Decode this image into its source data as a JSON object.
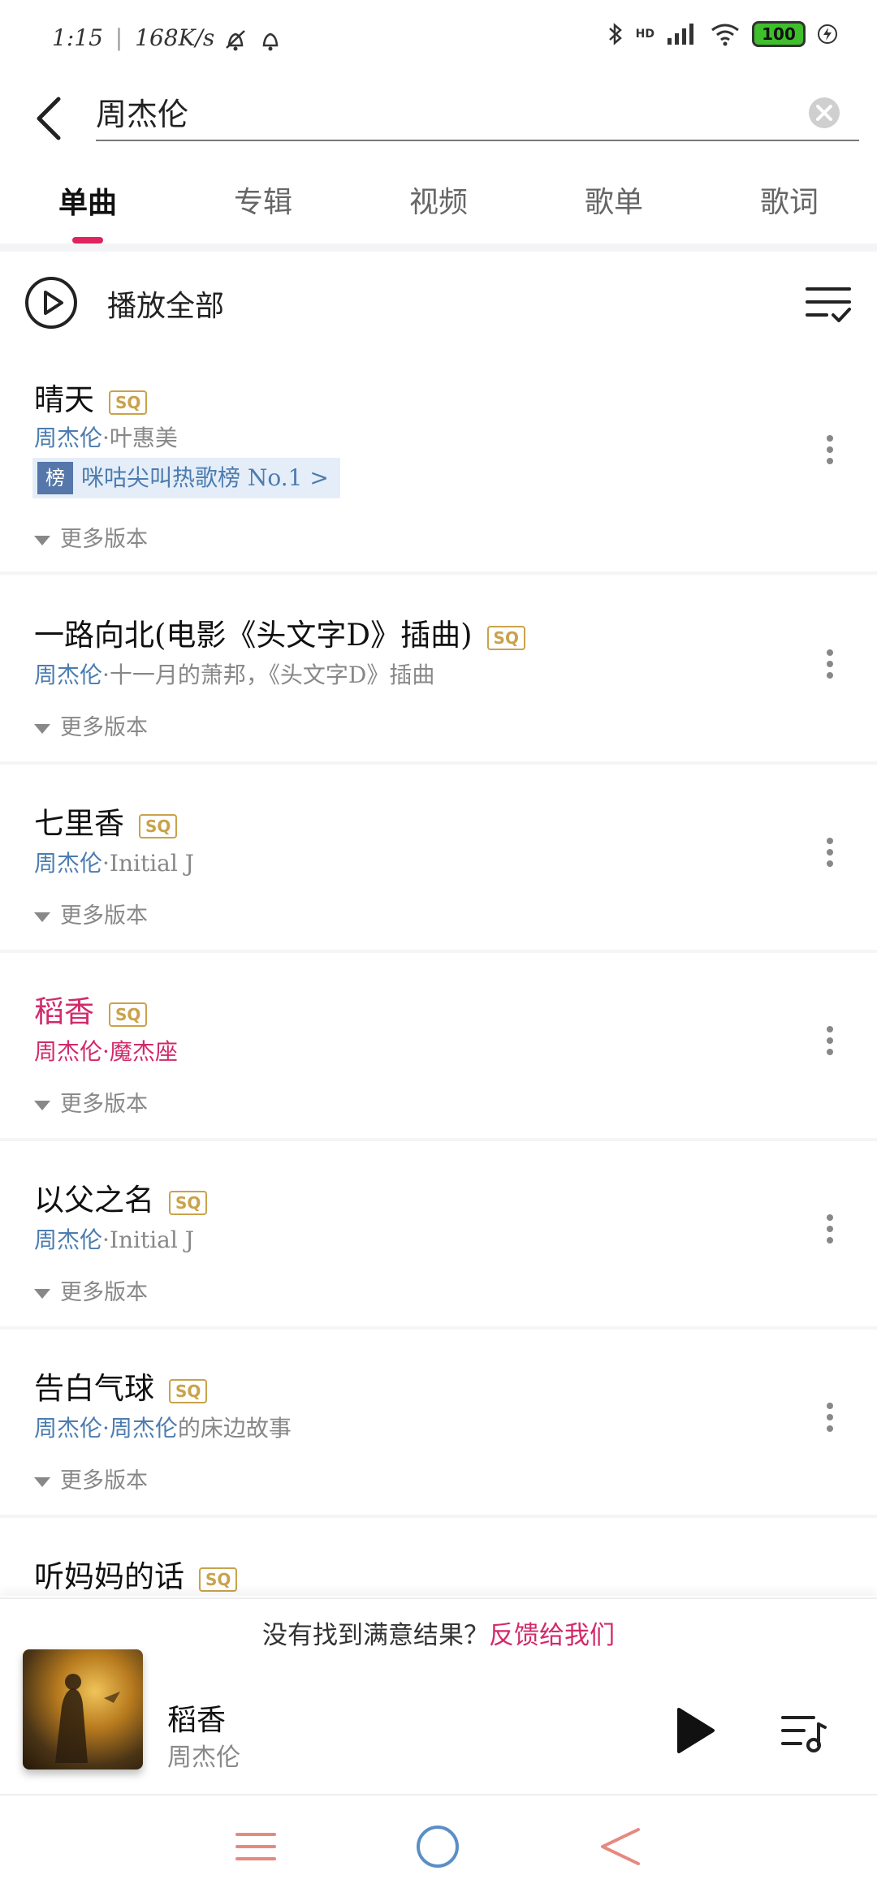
{
  "status_bar": {
    "time": "1:15",
    "net_speed": "168K/s",
    "network": "HD",
    "battery": "100"
  },
  "search": {
    "query": "周杰伦"
  },
  "tabs": [
    {
      "label": "单曲",
      "active": true
    },
    {
      "label": "专辑",
      "active": false
    },
    {
      "label": "视频",
      "active": false
    },
    {
      "label": "歌单",
      "active": false
    },
    {
      "label": "歌词",
      "active": false
    }
  ],
  "play_all": {
    "label": "播放全部"
  },
  "songs": [
    {
      "title": "晴天",
      "quality": "SQ",
      "artist": "周杰伦",
      "sub_rest": "·叶惠美",
      "rank_badge": "榜",
      "rank_text": "咪咕尖叫热歌榜 No.1 >",
      "more": "更多版本"
    },
    {
      "title": "一路向北(电影《头文字D》插曲)",
      "quality": "SQ",
      "artist": "周杰伦",
      "sub_rest": "·十一月的萧邦，《头文字D》插曲",
      "more": "更多版本"
    },
    {
      "title": "七里香",
      "quality": "SQ",
      "artist": "周杰伦",
      "sub_rest": "·Initial J",
      "more": "更多版本"
    },
    {
      "title": "稻香",
      "quality": "SQ",
      "artist": "周杰伦",
      "sub_rest": "·魔杰座",
      "more": "更多版本",
      "playing": true
    },
    {
      "title": "以父之名",
      "quality": "SQ",
      "artist": "周杰伦",
      "sub_rest": "·Initial J",
      "more": "更多版本"
    },
    {
      "title": "告白气球",
      "quality": "SQ",
      "artist": "周杰伦",
      "artist2": "·周杰伦",
      "sub_rest": "的床边故事",
      "more": "更多版本"
    },
    {
      "title": "听妈妈的话",
      "quality": "SQ"
    }
  ],
  "feedback": {
    "prompt": "没有找到满意结果？",
    "link": "反馈给我们"
  },
  "player": {
    "title": "稻香",
    "artist": "周杰伦"
  },
  "colors": {
    "accent": "#e0245e",
    "artist_link": "#4c7cb0",
    "sq_gold": "#c9a24b",
    "nav_icons": "#e58a80"
  }
}
